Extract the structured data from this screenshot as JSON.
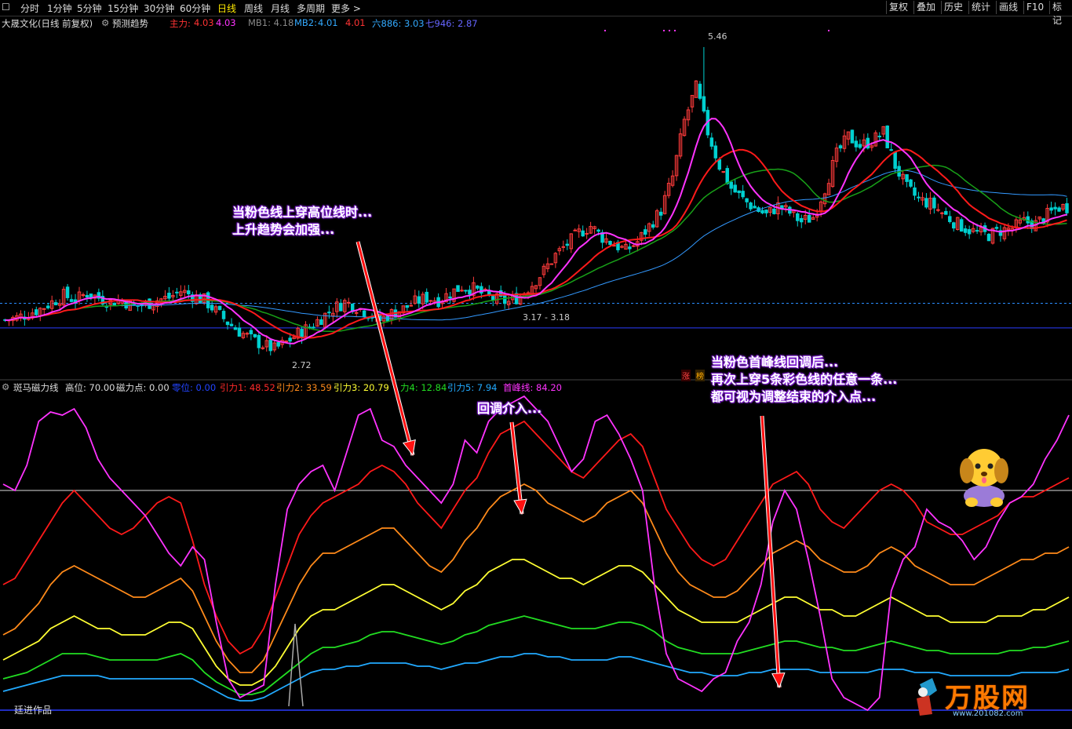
{
  "toolbar": {
    "periods": [
      "分时",
      "1分钟",
      "5分钟",
      "15分钟",
      "30分钟",
      "60分钟",
      "日线",
      "周线",
      "月线",
      "多周期",
      "更多 >"
    ],
    "active": "日线",
    "right_buttons": [
      "复权",
      "叠加",
      "历史",
      "统计",
      "画线",
      "F10",
      "标记"
    ]
  },
  "main_info": {
    "stock": "大晟文化(日线 前复权)",
    "trend_btn": "预测趋势",
    "zl_label": "主力:",
    "zl_val1": "4.03",
    "zl_val2": "4.03",
    "mb1": "MB1: 4.18",
    "mb2_label": "MB2:",
    "mb2_val1": "4.01",
    "mb2_val2": "4.01",
    "six": "六886: 3.03",
    "seven": "七946: 2.87"
  },
  "main_marks": {
    "high": "5.46",
    "low": "2.72",
    "range": "3.17 - 3.18"
  },
  "badges": [
    "涨",
    "榜"
  ],
  "ind_info": {
    "name": "斑马磁力线",
    "level": "高位: 70.00",
    "cili": "磁力点: 0.00",
    "zero": "零位: 0.00",
    "y1": "引力1: 48.52",
    "y2": "引力2: 33.59",
    "y3": "引力3: 20.79",
    "y4": "力4: 12.84",
    "y5": "引力5: 7.94",
    "peak": "首峰线: 84.20"
  },
  "annotations": {
    "a1_l1": "当粉色线上穿高位线时...",
    "a1_l2": "上升趋势会加强...",
    "a2": "回调介入...",
    "a3_l1": "当粉色首峰线回调后...",
    "a3_l2": "再次上穿5条彩色线的任意一条...",
    "a3_l3": "都可视为调整结束的介入点..."
  },
  "footer": "廷进作品",
  "watermark": {
    "brand": "万股网",
    "site": "www.201082.com"
  },
  "colors": {
    "up": "#ff3b3b",
    "down": "#00d0d0",
    "pink": "#ff33ff",
    "red": "#ff1a1a",
    "green": "#18a018",
    "blue": "#2a8cff",
    "yellow": "#ffff33",
    "orange": "#ff8a1a",
    "lime": "#22dd22",
    "cyan": "#22aaff"
  },
  "chart_data": [
    {
      "type": "candlestick",
      "title": "大晟文化(日线 前复权)",
      "ylim": [
        2.5,
        5.6
      ],
      "reference_lines": [
        3.17,
        2.95
      ],
      "annotated_high": 5.46,
      "annotated_low": 2.72,
      "close_path": [
        3.02,
        3.04,
        3.08,
        3.12,
        3.18,
        3.24,
        3.2,
        3.26,
        3.22,
        3.18,
        3.2,
        3.14,
        3.16,
        3.2,
        3.22,
        3.28,
        3.24,
        3.2,
        3.1,
        3.0,
        2.92,
        2.85,
        2.8,
        2.76,
        2.82,
        2.9,
        2.96,
        3.04,
        3.12,
        3.18,
        3.14,
        3.08,
        3.02,
        3.08,
        3.12,
        3.18,
        3.22,
        3.2,
        3.26,
        3.32,
        3.3,
        3.24,
        3.2,
        3.18,
        3.24,
        3.34,
        3.46,
        3.6,
        3.7,
        3.8,
        3.86,
        3.76,
        3.7,
        3.64,
        3.72,
        3.86,
        4.0,
        4.3,
        4.8,
        5.1,
        4.7,
        4.4,
        4.2,
        4.1,
        4.02,
        3.96,
        4.04,
        3.98,
        3.9,
        3.94,
        4.2,
        4.5,
        4.66,
        4.58,
        4.62,
        4.7,
        4.4,
        4.2,
        4.1,
        4.06,
        3.98,
        3.9,
        3.84,
        3.8,
        3.78,
        3.82,
        3.84,
        3.9,
        3.88,
        3.96,
        4.03
      ]
    },
    {
      "type": "line",
      "title": "斑马磁力线",
      "ylim": [
        0,
        100
      ],
      "reference_lines": [
        70,
        0
      ],
      "series": [
        {
          "name": "首峰线",
          "values": [
            72,
            70,
            78,
            92,
            95,
            94,
            96,
            90,
            80,
            74,
            70,
            66,
            62,
            56,
            50,
            46,
            52,
            48,
            28,
            10,
            4,
            6,
            8,
            40,
            64,
            72,
            76,
            78,
            70,
            82,
            94,
            96,
            86,
            84,
            78,
            74,
            70,
            66,
            72,
            86,
            82,
            92,
            96,
            98,
            100,
            96,
            92,
            84,
            76,
            80,
            92,
            94,
            88,
            80,
            70,
            40,
            18,
            10,
            8,
            6,
            10,
            12,
            22,
            28,
            40,
            60,
            70,
            64,
            48,
            30,
            10,
            4,
            2,
            0,
            4,
            38,
            48,
            52,
            64,
            60,
            58,
            54,
            48,
            52,
            60,
            66,
            68,
            72,
            80,
            86,
            94
          ]
        },
        {
          "name": "引力1",
          "values": [
            40,
            42,
            48,
            54,
            60,
            66,
            70,
            66,
            62,
            58,
            56,
            58,
            62,
            66,
            68,
            66,
            54,
            40,
            30,
            22,
            18,
            20,
            26,
            36,
            46,
            56,
            62,
            66,
            68,
            70,
            72,
            76,
            78,
            76,
            72,
            66,
            62,
            58,
            64,
            70,
            74,
            82,
            88,
            90,
            92,
            88,
            84,
            80,
            76,
            74,
            78,
            82,
            86,
            88,
            84,
            74,
            64,
            58,
            52,
            48,
            46,
            48,
            54,
            60,
            66,
            72,
            74,
            76,
            72,
            64,
            60,
            58,
            62,
            66,
            70,
            72,
            70,
            66,
            60,
            58,
            56,
            56,
            58,
            60,
            62,
            66,
            68,
            68,
            70,
            72,
            74
          ]
        },
        {
          "name": "引力2",
          "values": [
            24,
            26,
            30,
            34,
            40,
            44,
            46,
            44,
            42,
            40,
            38,
            36,
            36,
            38,
            40,
            42,
            38,
            30,
            22,
            16,
            12,
            12,
            16,
            24,
            32,
            40,
            46,
            50,
            50,
            52,
            54,
            56,
            58,
            58,
            54,
            50,
            46,
            44,
            48,
            54,
            58,
            64,
            68,
            70,
            72,
            70,
            66,
            64,
            62,
            60,
            62,
            66,
            68,
            70,
            66,
            58,
            50,
            44,
            40,
            38,
            36,
            36,
            38,
            42,
            46,
            50,
            52,
            54,
            52,
            48,
            46,
            44,
            44,
            46,
            50,
            52,
            50,
            46,
            44,
            42,
            40,
            40,
            40,
            42,
            44,
            46,
            48,
            48,
            50,
            50,
            52
          ]
        },
        {
          "name": "引力3",
          "values": [
            16,
            18,
            20,
            22,
            26,
            28,
            30,
            28,
            26,
            26,
            24,
            24,
            24,
            26,
            28,
            28,
            26,
            20,
            14,
            10,
            8,
            8,
            10,
            14,
            20,
            26,
            30,
            32,
            32,
            34,
            36,
            38,
            40,
            40,
            38,
            36,
            34,
            32,
            34,
            38,
            40,
            44,
            46,
            48,
            48,
            46,
            44,
            42,
            42,
            40,
            42,
            44,
            46,
            46,
            44,
            40,
            36,
            32,
            30,
            28,
            28,
            28,
            28,
            30,
            32,
            34,
            36,
            36,
            34,
            32,
            32,
            30,
            30,
            32,
            34,
            36,
            34,
            32,
            30,
            30,
            28,
            28,
            28,
            28,
            30,
            30,
            30,
            32,
            32,
            34,
            36
          ]
        },
        {
          "name": "力4",
          "values": [
            10,
            11,
            12,
            14,
            16,
            18,
            18,
            18,
            17,
            16,
            16,
            16,
            16,
            16,
            17,
            18,
            16,
            12,
            9,
            7,
            5,
            5,
            6,
            9,
            12,
            15,
            18,
            20,
            20,
            21,
            22,
            24,
            25,
            25,
            24,
            23,
            22,
            21,
            22,
            24,
            25,
            27,
            28,
            29,
            30,
            29,
            28,
            27,
            26,
            26,
            26,
            27,
            28,
            28,
            27,
            25,
            22,
            20,
            19,
            18,
            18,
            18,
            18,
            19,
            20,
            21,
            22,
            22,
            21,
            20,
            20,
            19,
            19,
            20,
            21,
            22,
            21,
            20,
            19,
            19,
            18,
            18,
            18,
            18,
            18,
            19,
            19,
            20,
            20,
            21,
            22
          ]
        },
        {
          "name": "引力5",
          "values": [
            6,
            7,
            8,
            9,
            10,
            11,
            11,
            11,
            11,
            10,
            10,
            10,
            10,
            10,
            10,
            10,
            10,
            8,
            6,
            4,
            3,
            3,
            4,
            6,
            8,
            10,
            12,
            13,
            13,
            14,
            14,
            15,
            15,
            15,
            15,
            14,
            14,
            13,
            14,
            15,
            15,
            16,
            17,
            17,
            18,
            18,
            17,
            17,
            16,
            16,
            16,
            16,
            17,
            17,
            16,
            15,
            14,
            13,
            12,
            12,
            11,
            11,
            11,
            12,
            12,
            13,
            13,
            13,
            13,
            12,
            12,
            12,
            12,
            12,
            13,
            13,
            13,
            12,
            12,
            12,
            11,
            11,
            11,
            11,
            11,
            11,
            12,
            12,
            12,
            12,
            13
          ]
        }
      ]
    }
  ]
}
